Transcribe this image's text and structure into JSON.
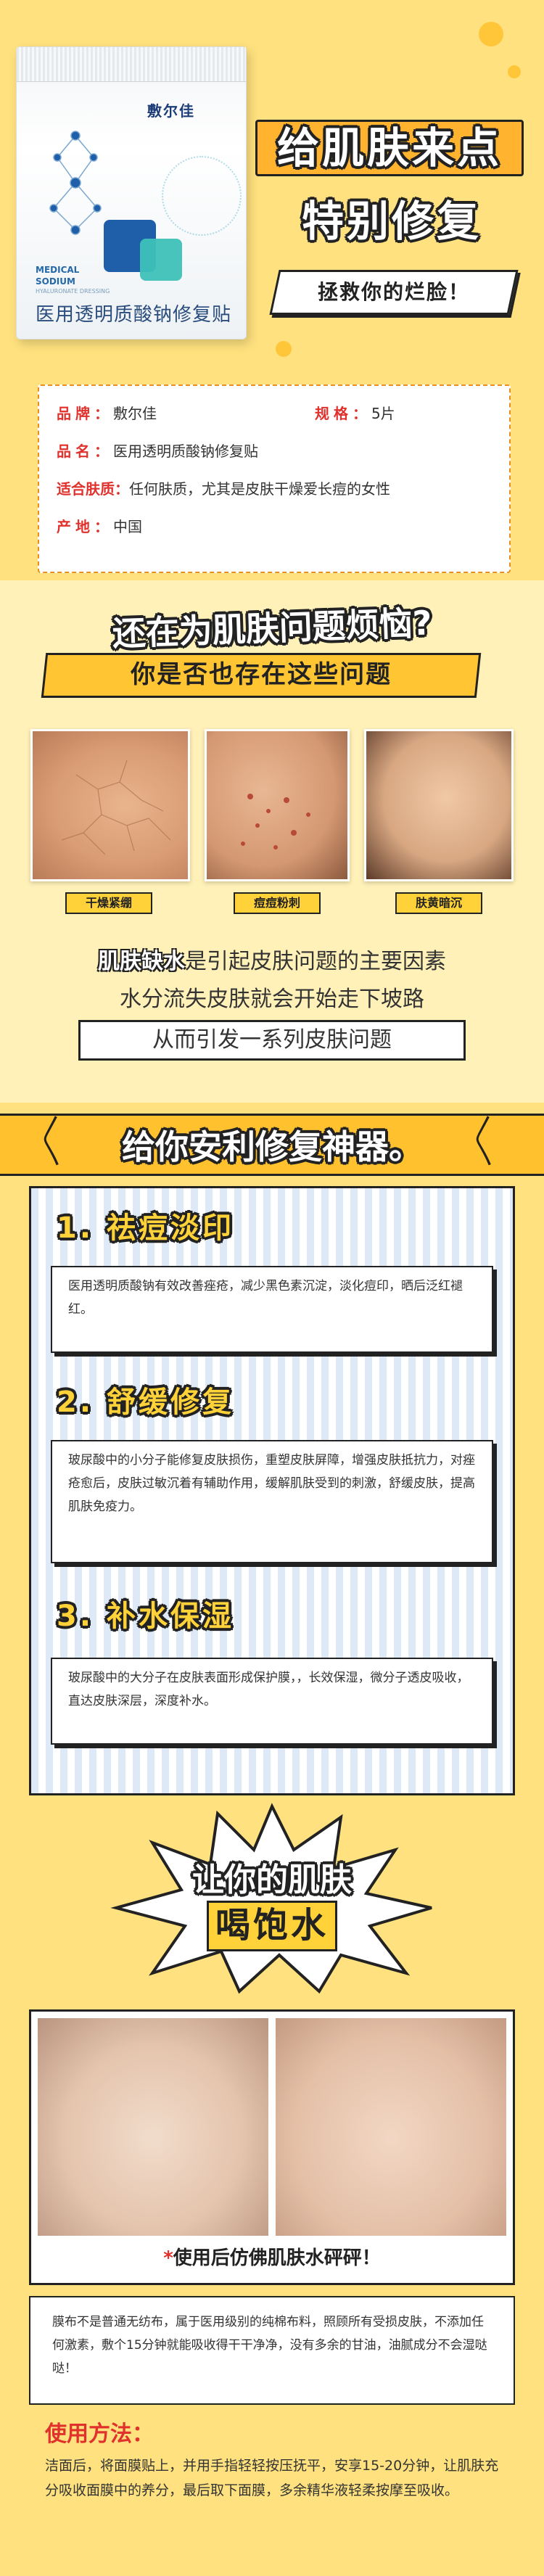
{
  "hero": {
    "pack_brand": "敷尔佳",
    "pack_medical": "MEDICAL",
    "pack_sodium": "SODIUM",
    "pack_sub": "HYALURONATE DRESSING",
    "pack_name": "医用透明质酸钠修复贴",
    "title_line1": "给肌肤来点",
    "title_line2": "特别修复",
    "ribbon": "拯救你的烂脸！"
  },
  "info": {
    "rows": [
      {
        "key": "品牌：",
        "value": "敷尔佳"
      },
      {
        "key": "规格：",
        "value": "5片"
      },
      {
        "key": "品名：",
        "value": "医用透明质酸钠修复贴"
      },
      {
        "key": "适合肤质：",
        "value": "任何肤质，尤其是皮肤干燥爱长痘的女性"
      },
      {
        "key": "产地：",
        "value": "中国"
      }
    ]
  },
  "problems": {
    "title1": "还在为肌肤问题烦恼?",
    "title2": "你是否也存在这些问题",
    "labels": [
      "干燥紧绷",
      "痘痘粉刺",
      "肤黄暗沉"
    ],
    "cause_highlight": "肌肤缺水",
    "cause_rest": "是引起皮肤问题的主要因素",
    "line2": "水分流失皮肤就会开始走下坡路",
    "line3": "从而引发一系列皮肤问题"
  },
  "repair": {
    "title": "给你安利修复神器。",
    "steps": [
      {
        "title": "1. 祛痘淡印",
        "text": "医用透明质酸钠有效改善痤疮，减少黑色素沉淀，淡化痘印，晒后泛红褪红。"
      },
      {
        "title": "2. 舒缓修复",
        "text": "玻尿酸中的小分子能修复皮肤损伤，重塑皮肤屏障，增强皮肤抵抗力，对痤疮愈后，皮肤过敏沉着有辅助作用，缓解肌肤受到的刺激，舒缓皮肤，提高肌肤免疫力。"
      },
      {
        "title": "3. 补水保湿",
        "text": "玻尿酸中的大分子在皮肤表面形成保护膜，，长效保湿，微分子透皮吸收，直达皮肤深层，深度补水。"
      }
    ]
  },
  "hydrate": {
    "title1": "让你的肌肤",
    "title2": "喝饱水",
    "caption_star": "*",
    "caption": "使用后仿佛肌肤水砰砰！",
    "note": "膜布不是普通无纺布，属于医用级别的纯棉布料，照顾所有受损皮肤，不添加任何激素，敷个15分钟就能吸收得干干净净，没有多余的甘油，油腻成分不会湿哒哒！",
    "usage_title": "使用方法：",
    "usage_text": "洁面后，将面膜贴上，并用手指轻轻按压抚平，安享15-20分钟，让肌肤充分吸收面膜中的养分，最后取下面膜，多余精华液轻柔按摩至吸收。"
  },
  "colors": {
    "background": "#FFE27F",
    "accent_orange": "#FFC22E",
    "key_red": "#E0312C",
    "pack_blue": "#1f5fa9",
    "pack_teal": "#3ec1b9"
  }
}
